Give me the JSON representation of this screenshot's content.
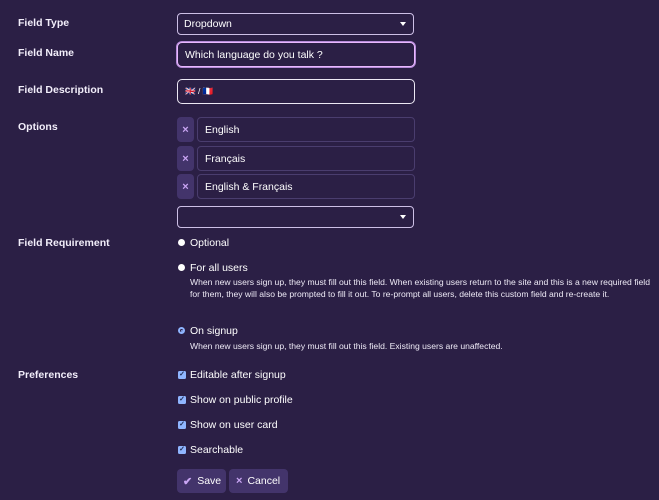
{
  "labels": {
    "field_type": "Field Type",
    "field_name": "Field Name",
    "field_description": "Field Description",
    "options": "Options",
    "field_requirement": "Field Requirement",
    "preferences": "Preferences"
  },
  "field_type": {
    "value": "Dropdown"
  },
  "field_name": {
    "value": "Which language do you talk ?"
  },
  "field_description": {
    "value": "🇬🇧 / 🇫🇷"
  },
  "options": {
    "items": [
      "English",
      "Français",
      "English & Français"
    ],
    "remove_icon": "×",
    "new_option_value": ""
  },
  "requirement": {
    "optional": {
      "label": "Optional"
    },
    "for_all_users": {
      "label": "For all users",
      "description": "When new users sign up, they must fill out this field. When existing users return to the site and this is a new required field for them, they will also be prompted to fill it out. To re-prompt all users, delete this custom field and re-create it."
    },
    "on_signup": {
      "label": "On signup",
      "description": "When new users sign up, they must fill out this field. Existing users are unaffected."
    },
    "selected": "on_signup"
  },
  "preferences": {
    "editable_after_signup": {
      "label": "Editable after signup",
      "checked": true
    },
    "show_on_public_profile": {
      "label": "Show on public profile",
      "checked": true
    },
    "show_on_user_card": {
      "label": "Show on user card",
      "checked": true
    },
    "searchable": {
      "label": "Searchable",
      "checked": true
    },
    "check_glyph": "✓"
  },
  "actions": {
    "save_label": "Save",
    "save_icon": "✔",
    "cancel_label": "Cancel",
    "cancel_icon": "×"
  },
  "colors": {
    "background": "#2b1f45",
    "focus_border": "#e9b8ff",
    "accent": "#8fb5ff",
    "icon_accent": "#c9a5f3"
  }
}
